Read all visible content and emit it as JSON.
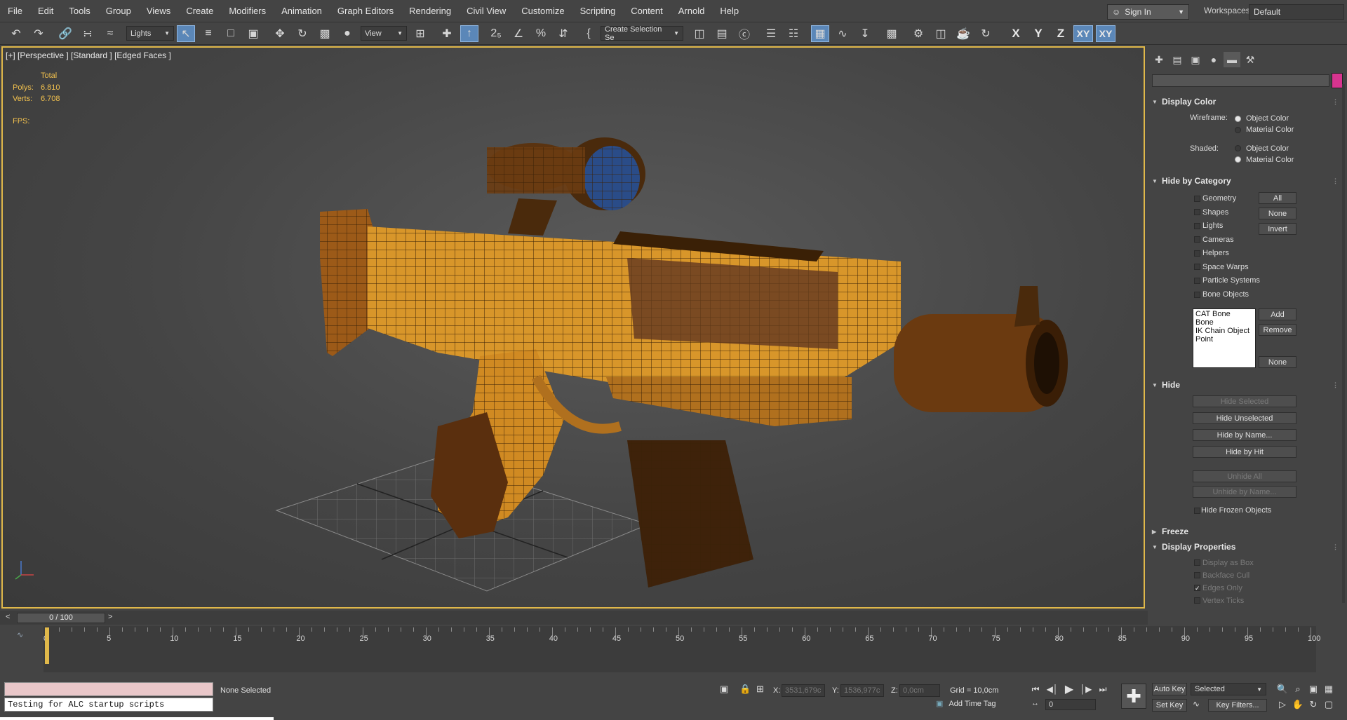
{
  "menu": [
    "File",
    "Edit",
    "Tools",
    "Group",
    "Views",
    "Create",
    "Modifiers",
    "Animation",
    "Graph Editors",
    "Rendering",
    "Civil View",
    "Customize",
    "Scripting",
    "Content",
    "Arnold",
    "Help"
  ],
  "account": {
    "sign_in": "Sign In",
    "workspaces_label": "Workspaces:",
    "workspace": "Default"
  },
  "toolbar": {
    "filter": "Lights",
    "ref_coord": "View",
    "selection_set": "Create Selection Se",
    "axes": [
      "X",
      "Y",
      "Z",
      "XY",
      "XY"
    ]
  },
  "viewport": {
    "label": "[+] [Perspective ] [Standard ] [Edged Faces ]",
    "stats": {
      "total_label": "Total",
      "polys_label": "Polys:",
      "polys": "6.810",
      "verts_label": "Verts:",
      "verts": "6.708",
      "fps_label": "FPS:"
    }
  },
  "command_panel": {
    "display_color": {
      "title": "Display Color",
      "wireframe_label": "Wireframe:",
      "shaded_label": "Shaded:",
      "object_color": "Object Color",
      "material_color": "Material Color"
    },
    "hide_by_category": {
      "title": "Hide by Category",
      "categories": [
        "Geometry",
        "Shapes",
        "Lights",
        "Cameras",
        "Helpers",
        "Space Warps",
        "Particle Systems",
        "Bone Objects"
      ],
      "btn_all": "All",
      "btn_none": "None",
      "btn_invert": "Invert",
      "list": [
        "CAT Bone",
        "Bone",
        "IK Chain Object",
        "Point"
      ],
      "btn_add": "Add",
      "btn_remove": "Remove",
      "btn_none2": "None"
    },
    "hide": {
      "title": "Hide",
      "hide_selected": "Hide Selected",
      "hide_unselected": "Hide Unselected",
      "hide_by_name": "Hide by Name...",
      "hide_by_hit": "Hide by Hit",
      "unhide_all": "Unhide All",
      "unhide_by_name": "Unhide by Name...",
      "hide_frozen": "Hide Frozen Objects"
    },
    "freeze": {
      "title": "Freeze"
    },
    "display_properties": {
      "title": "Display Properties",
      "items": [
        "Display as Box",
        "Backface Cull",
        "Edges Only",
        "Vertex Ticks"
      ]
    }
  },
  "timeline": {
    "slider_text": "0 / 100",
    "ticks": [
      "0",
      "5",
      "10",
      "15",
      "20",
      "25",
      "30",
      "35",
      "40",
      "45",
      "50",
      "55",
      "60",
      "65",
      "70",
      "75",
      "80",
      "85",
      "90",
      "95",
      "100"
    ],
    "current_frame": 0
  },
  "status": {
    "listener_text": "Testing for ALC startup scripts",
    "selection": "None Selected",
    "x_label": "X:",
    "x": "3531,679c",
    "y_label": "Y:",
    "y": "1536,977c",
    "z_label": "Z:",
    "z": "0,0cm",
    "grid": "Grid = 10,0cm",
    "add_time_tag": "Add Time Tag",
    "frame": "0",
    "auto_key": "Auto Key",
    "set_key": "Set Key",
    "key_mode": "Selected",
    "key_filters": "Key Filters..."
  },
  "colors": {
    "accent": "#5b87b8",
    "viewport_border": "#e0b84a",
    "stat_text": "#f2c14e",
    "object_swatch": "#d8348f"
  }
}
